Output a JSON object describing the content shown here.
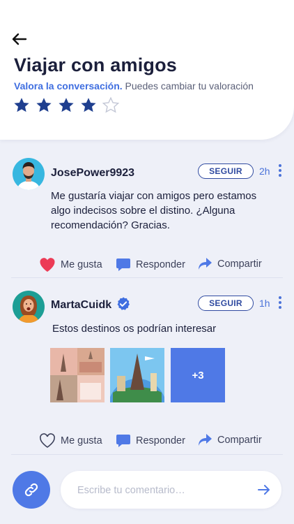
{
  "header": {
    "title": "Viajar con amigos",
    "rate_label": "Valora la conversación.",
    "rate_hint": "Puedes cambiar tu valoración",
    "rating": {
      "value": 4,
      "max": 5
    }
  },
  "posts": [
    {
      "username": "JosePower9923",
      "verified": false,
      "follow_label": "SEGUIR",
      "time": "2h",
      "text": "Me gustaría viajar con amigos pero estamos algo indecisos sobre el distino. ¿Alguna recomendación? Gracias.",
      "liked": true,
      "like_label": "Me gusta",
      "reply_label": "Responder",
      "share_label": "Compartir"
    },
    {
      "username": "MartaCuidk",
      "verified": true,
      "follow_label": "SEGUIR",
      "time": "1h",
      "text": "Estos destinos os podrían interesar",
      "more_images_label": "+3",
      "liked": false,
      "like_label": "Me gusta",
      "reply_label": "Responder",
      "share_label": "Compartir"
    }
  ],
  "composer": {
    "placeholder": "Escribe tu comentario…"
  },
  "colors": {
    "accent": "#4f79e6",
    "dark_blue": "#1f3f8f",
    "like_red": "#ec3b56",
    "background": "#eef0f8"
  },
  "icons": [
    "back-arrow-icon",
    "star-icon",
    "verified-badge-icon",
    "more-vertical-icon",
    "heart-icon",
    "comment-icon",
    "share-icon",
    "link-icon",
    "send-arrow-icon"
  ]
}
